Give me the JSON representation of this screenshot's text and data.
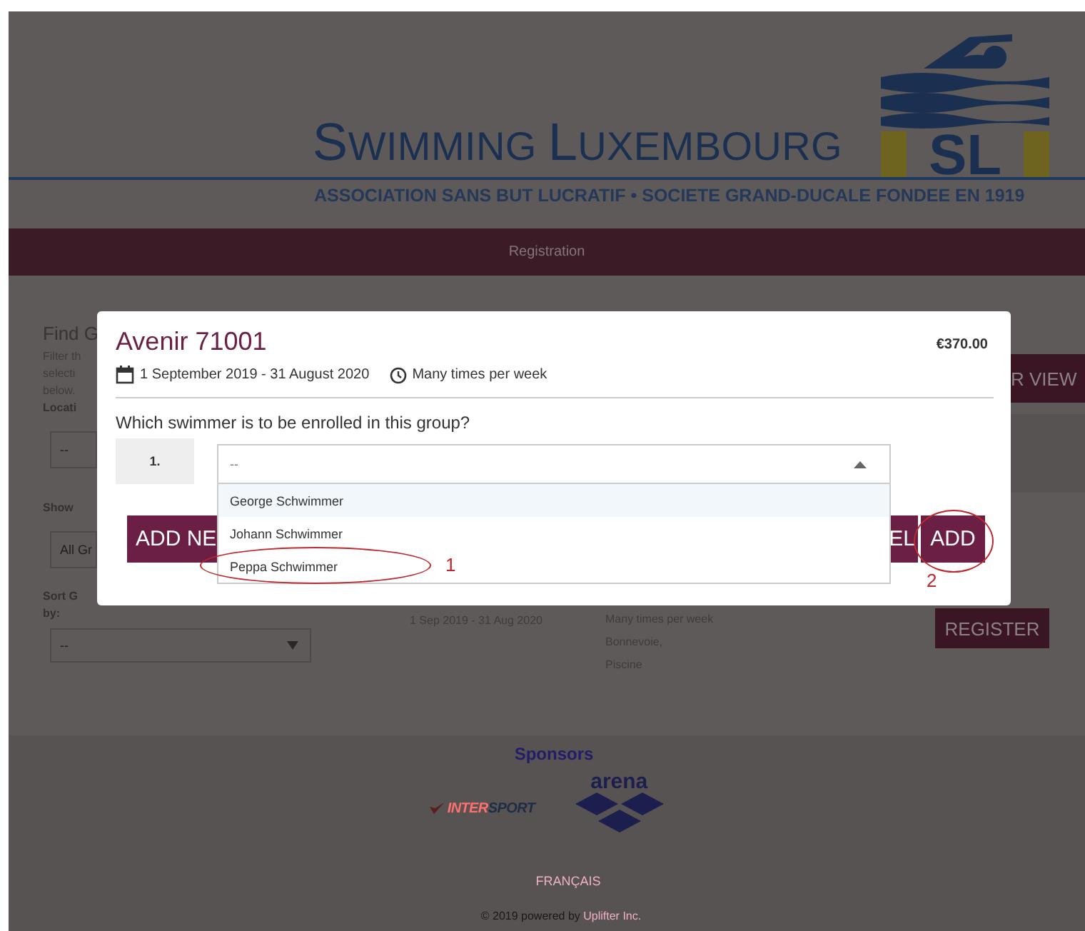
{
  "header": {
    "title": "SWIMMING LUXEMBOURG",
    "logo_mark": "SL",
    "tagline": "ASSOCIATION SANS BUT LUCRATIF • SOCIETE GRAND-DUCALE FONDEE EN 1919"
  },
  "nav": {
    "label": "Registration"
  },
  "filters": {
    "heading": "Find G",
    "description": [
      "Filter th",
      "selecti",
      "below."
    ],
    "location": {
      "label": "Locati",
      "value": "--"
    },
    "show": {
      "label": "Show",
      "value": "All Gr"
    },
    "sort": {
      "label": [
        "Sort G",
        "by:"
      ],
      "value": "--"
    }
  },
  "list_view_button": "R VIEW",
  "group_row": {
    "dates": "1 Sep 2019 - 31 Aug 2020",
    "schedule": "Many times per week",
    "location": [
      "Bonnevoie,",
      "Piscine"
    ],
    "register_button": "REGISTER"
  },
  "modal": {
    "title": "Avenir 71001",
    "price": "€370.00",
    "dates": "1 September 2019 - 31 August 2020",
    "schedule": "Many times per week",
    "question": "Which swimmer is to be enrolled in this group?",
    "rows": [
      {
        "number": "1.",
        "select": {
          "value": "--",
          "expanded": true,
          "options": [
            {
              "label": "George Schwimmer",
              "highlighted": true,
              "circled": false
            },
            {
              "label": "Johann Schwimmer",
              "highlighted": false,
              "circled": false
            },
            {
              "label": "Peppa Schwimmer",
              "highlighted": false,
              "circled": true,
              "annotation": "1"
            }
          ]
        }
      }
    ],
    "buttons": [
      {
        "label": "ADD NE",
        "kind": "add-new"
      },
      {
        "label": "EL",
        "kind": "cancel"
      },
      {
        "label": "ADD",
        "kind": "add",
        "circled": true,
        "annotation": "2"
      }
    ]
  },
  "footer": {
    "sponsors_heading": "Sponsors",
    "sponsors": [
      {
        "kind": "intersport",
        "name": "INTERSPORT"
      },
      {
        "kind": "arena",
        "name": "arena"
      }
    ],
    "language_link": "FRANÇAIS",
    "copyright": "© 2019 powered by",
    "copyright_link": "Uplifter Inc."
  }
}
